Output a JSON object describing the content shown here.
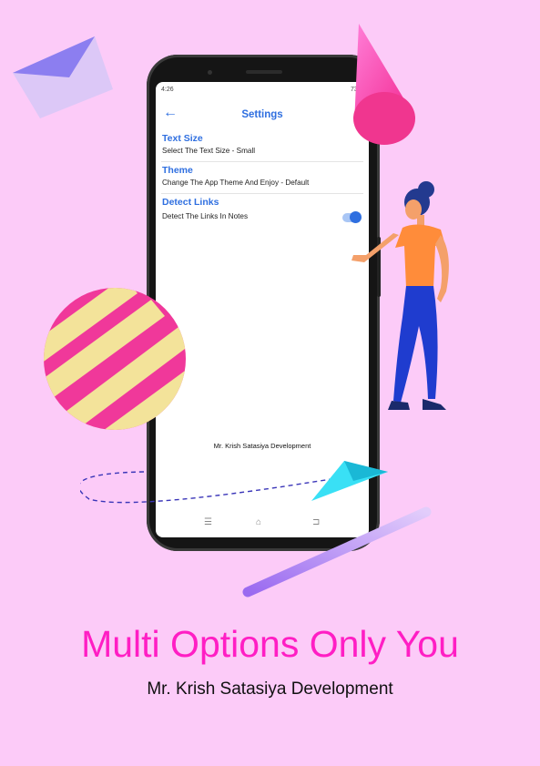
{
  "status_bar": {
    "time": "4:26",
    "right": "73%",
    "signal_icon": "signal-icon",
    "battery_icon": "battery-icon"
  },
  "app_bar": {
    "title": "Settings",
    "back_icon": "back-arrow-icon"
  },
  "settings": [
    {
      "title": "Text Size",
      "subtitle": "Select The Text Size - Small"
    },
    {
      "title": "Theme",
      "subtitle": "Change The App Theme And Enjoy - Default"
    },
    {
      "title": "Detect Links",
      "subtitle": "Detect The Links In Notes",
      "toggle_on": true
    }
  ],
  "app_footer": "Mr. Krish Satasiya Development",
  "nav_bar": [
    "menu-icon",
    "home-icon",
    "back-icon"
  ],
  "poster": {
    "headline": "Multi Options Only You",
    "subheadline": "Mr. Krish Satasiya Development"
  },
  "colors": {
    "background": "#fccbf8",
    "accent": "#2f6fe0",
    "headline": "#ff1ec4"
  }
}
